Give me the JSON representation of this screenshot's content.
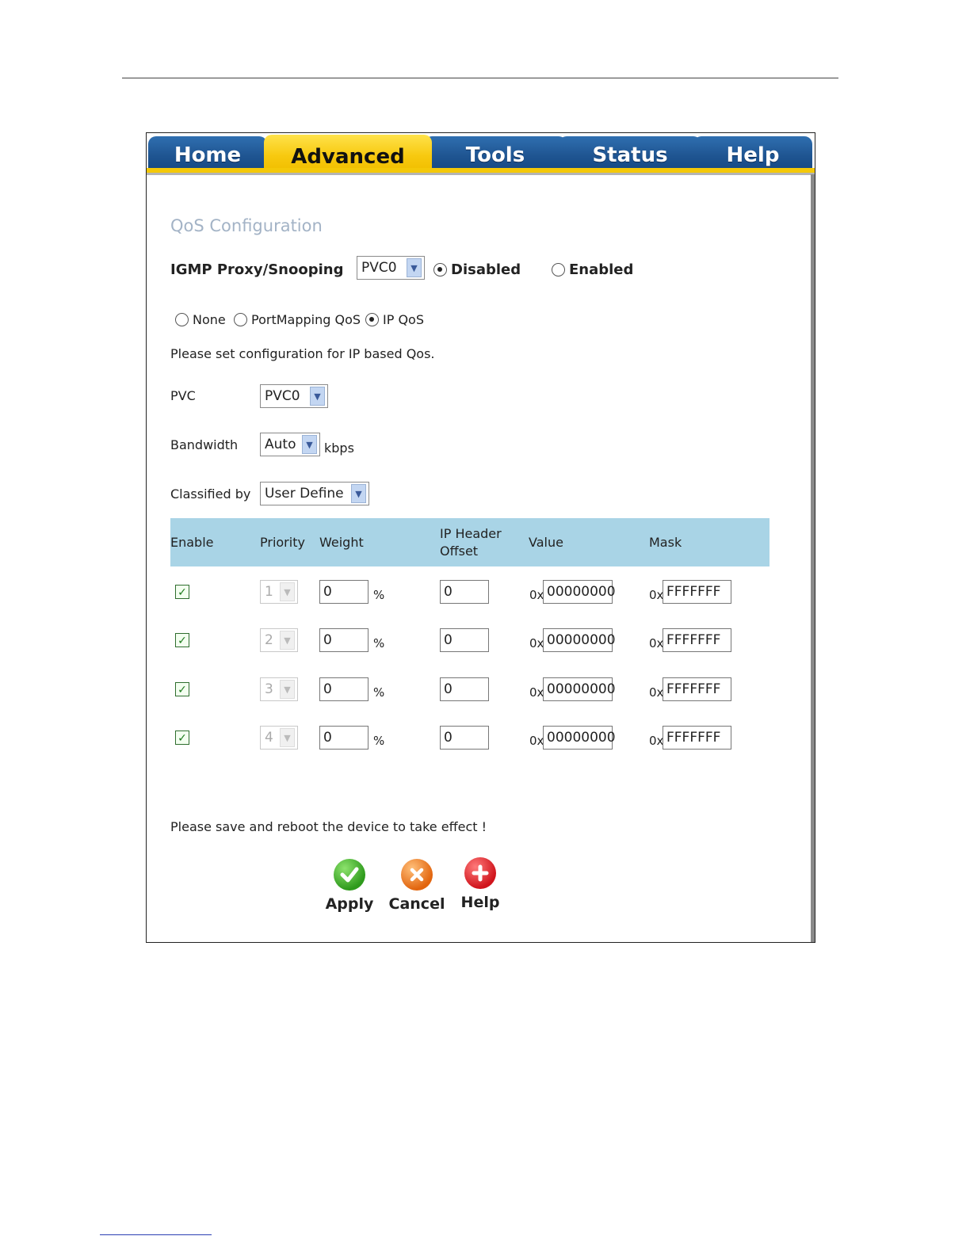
{
  "tabs": [
    {
      "label": "Home",
      "active": false
    },
    {
      "label": "Advanced",
      "active": true
    },
    {
      "label": "Tools",
      "active": false
    },
    {
      "label": "Status",
      "active": false
    },
    {
      "label": "Help",
      "active": false
    }
  ],
  "title": "QoS Configuration",
  "igmp": {
    "label": "IGMP Proxy/Snooping",
    "pvc": "PVC0",
    "disabled_label": "Disabled",
    "enabled_label": "Enabled",
    "selected": "Disabled"
  },
  "qos_mode": {
    "options": [
      "None",
      "PortMapping QoS",
      "IP QoS"
    ],
    "selected": "IP QoS"
  },
  "instructions": "Please set configuration for IP based Qos.",
  "pvc": {
    "label": "PVC",
    "value": "PVC0"
  },
  "bandwidth": {
    "label": "Bandwidth",
    "value": "Auto",
    "unit": "kbps"
  },
  "classified_by": {
    "label": "Classified by",
    "value": "User Define"
  },
  "table": {
    "headers": {
      "enable": "Enable",
      "priority": "Priority",
      "weight": "Weight",
      "offset_line1": "IP Header",
      "offset_line2": "Offset",
      "value": "Value",
      "mask": "Mask"
    },
    "percent": "%",
    "hex_prefix": "0x",
    "rows": [
      {
        "enabled": true,
        "priority": "1",
        "weight": "0",
        "offset": "0",
        "value": "00000000",
        "mask": "FFFFFFF"
      },
      {
        "enabled": true,
        "priority": "2",
        "weight": "0",
        "offset": "0",
        "value": "00000000",
        "mask": "FFFFFFF"
      },
      {
        "enabled": true,
        "priority": "3",
        "weight": "0",
        "offset": "0",
        "value": "00000000",
        "mask": "FFFFFFF"
      },
      {
        "enabled": true,
        "priority": "4",
        "weight": "0",
        "offset": "0",
        "value": "00000000",
        "mask": "FFFFFFF"
      }
    ]
  },
  "note": "Please save and reboot the device to take effect !",
  "buttons": {
    "apply": "Apply",
    "cancel": "Cancel",
    "help": "Help"
  },
  "colors": {
    "tab_blue": "#1f5592",
    "tab_active": "#f7c90f",
    "table_header": "#a9d4e6",
    "title": "#a3b3c6"
  }
}
